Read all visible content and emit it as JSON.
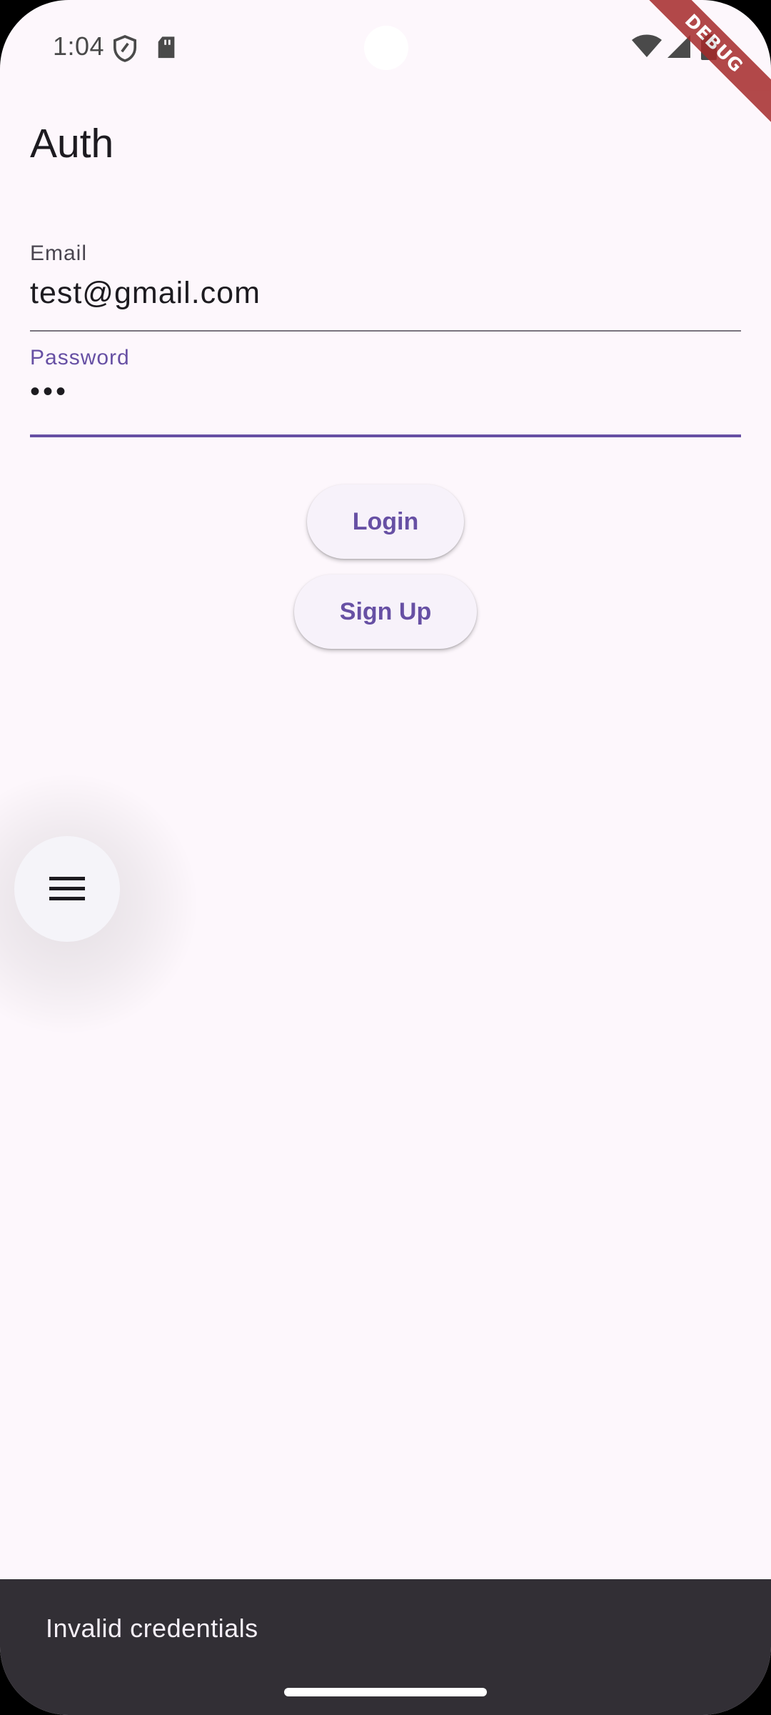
{
  "status_bar": {
    "time": "1:04",
    "icons": [
      "shield-icon",
      "sd-card-icon",
      "wifi-icon",
      "cellular-signal-icon",
      "battery-icon"
    ]
  },
  "debug_banner": "DEBUG",
  "app_bar": {
    "title": "Auth"
  },
  "form": {
    "email": {
      "label": "Email",
      "value": "test@gmail.com"
    },
    "password": {
      "label": "Password",
      "value": "•••"
    }
  },
  "buttons": {
    "login": "Login",
    "signup": "Sign Up"
  },
  "fab": {
    "icon": "menu-icon"
  },
  "snackbar": {
    "message": "Invalid credentials"
  },
  "colors": {
    "background": "#fdf7fc",
    "primary": "#6750a4",
    "snackbar": "#322f35",
    "debug_ribbon": "#a52a2a"
  }
}
